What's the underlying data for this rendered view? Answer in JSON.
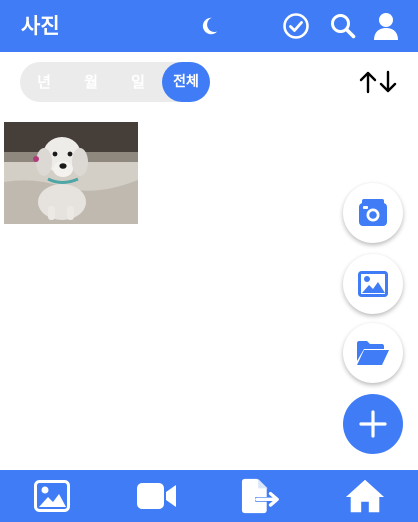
{
  "header": {
    "title": "사진",
    "icons": [
      "moon-icon",
      "check-circle-icon",
      "search-icon",
      "user-icon"
    ]
  },
  "filter": {
    "segments": [
      "년",
      "월",
      "일",
      "전체"
    ],
    "selected": "전체"
  },
  "sort": {
    "icons": [
      "arrow-up-icon",
      "arrow-down-icon"
    ]
  },
  "gallery": {
    "items": [
      {
        "subject": "dog-photo"
      }
    ]
  },
  "fab_menu": [
    "camera-icon",
    "image-icon",
    "folder-open-icon",
    "plus-icon"
  ],
  "bottom_nav": [
    "image-icon",
    "video-icon",
    "file-export-icon",
    "home-icon"
  ],
  "colors": {
    "primary": "#3f7cf5",
    "segment_bg": "#ebebeb",
    "background": "#ffffff"
  }
}
